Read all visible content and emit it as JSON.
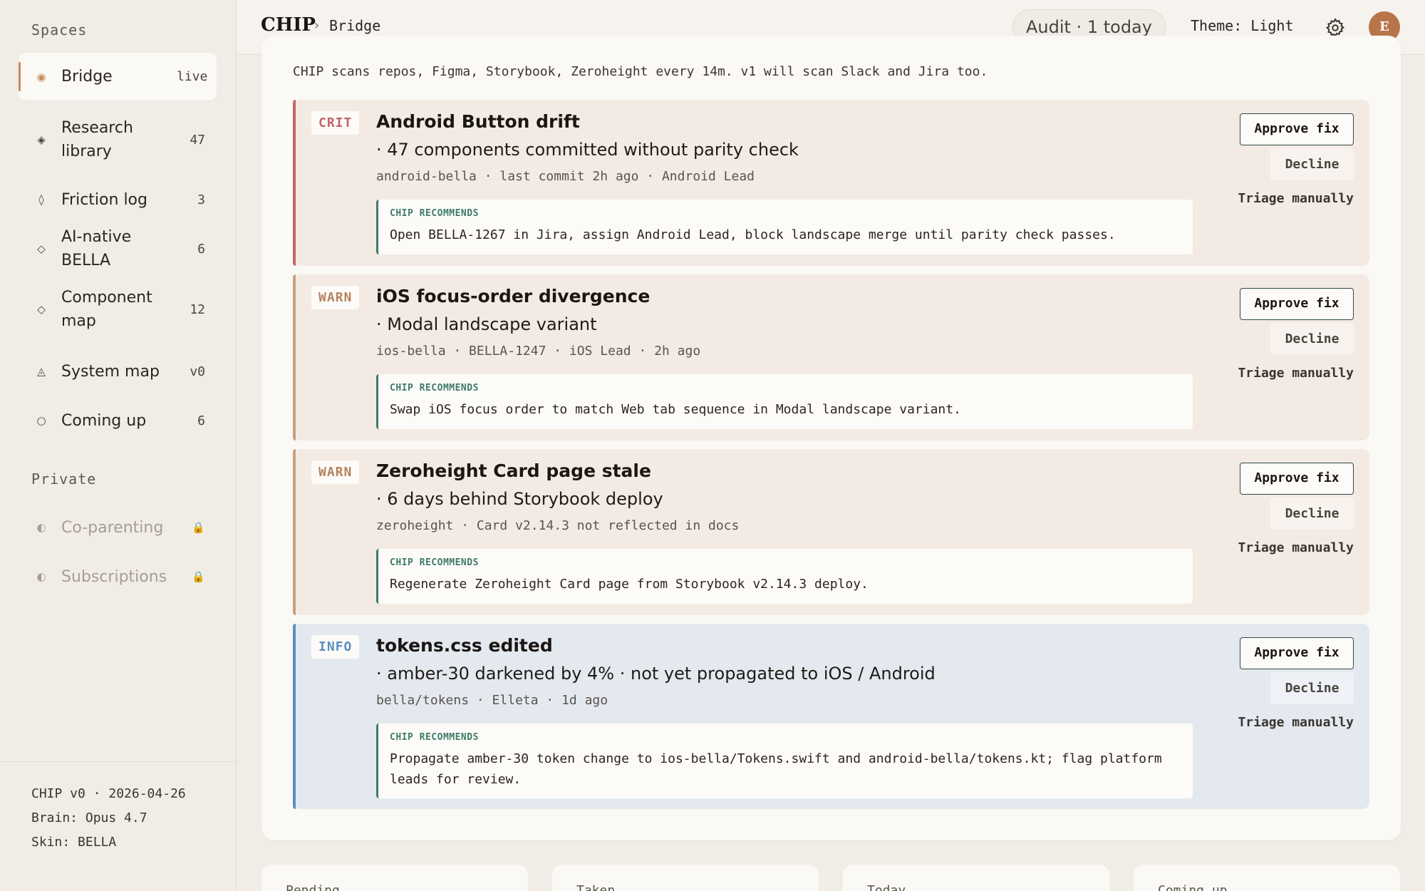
{
  "sidebar": {
    "spaces_heading": "Spaces",
    "items": [
      {
        "icon": "◉",
        "label": "Bridge",
        "count": "live"
      },
      {
        "icon": "◈",
        "label": "Research library",
        "count": "47"
      },
      {
        "icon": "◊",
        "label": "Friction log",
        "count": "3"
      },
      {
        "icon": "◇",
        "label": "AI-native BELLA",
        "count": "6"
      },
      {
        "icon": "◇",
        "label": "Component map",
        "count": "12"
      },
      {
        "icon": "◬",
        "label": "System map",
        "count": "v0"
      },
      {
        "icon": "○",
        "label": "Coming up",
        "count": "6"
      }
    ],
    "private_heading": "Private",
    "private_items": [
      {
        "icon": "◐",
        "label": "Co-parenting",
        "lock": "🔒"
      },
      {
        "icon": "◐",
        "label": "Subscriptions",
        "lock": "🔒"
      }
    ],
    "footer": {
      "version": "CHIP v0 · 2026-04-26",
      "brain": "Brain: Opus 4.7",
      "skin": "Skin: BELLA"
    }
  },
  "topbar": {
    "brand": "CHIP",
    "separator": "›",
    "crumb": "Bridge",
    "audit": "Audit · 1 today",
    "theme": "Theme: Light",
    "avatar_initial": "E"
  },
  "main": {
    "scan_note": "CHIP scans repos, Figma, Storybook, Zeroheight every 14m. v1 will scan Slack and Jira too.",
    "rec_label": "CHIP RECOMMENDS",
    "actions": {
      "approve": "Approve fix",
      "decline": "Decline",
      "triage": "Triage manually"
    },
    "alerts": [
      {
        "severity": "CRIT",
        "title": "Android Button drift",
        "subtitle": "· 47 components committed without parity check",
        "meta": "android-bella · last commit 2h ago · Android Lead",
        "recommendation": "Open BELLA-1267 in Jira, assign Android Lead, block landscape merge until parity check passes."
      },
      {
        "severity": "WARN",
        "title": "iOS focus-order divergence",
        "subtitle": "· Modal landscape variant",
        "meta": "ios-bella · BELLA-1247 · iOS Lead · 2h ago",
        "recommendation": "Swap iOS focus order to match Web tab sequence in Modal landscape variant."
      },
      {
        "severity": "WARN",
        "title": "Zeroheight Card page stale",
        "subtitle": "· 6 days behind Storybook deploy",
        "meta": "zeroheight · Card v2.14.3 not reflected in docs",
        "recommendation": "Regenerate Zeroheight Card page from Storybook v2.14.3 deploy."
      },
      {
        "severity": "INFO",
        "title": "tokens.css edited",
        "subtitle": "· amber-30 darkened by 4% · not yet propagated to iOS / Android",
        "meta": "bella/tokens · Elleta · 1d ago",
        "recommendation": "Propagate amber-30 token change to ios-bella/Tokens.swift and android-bella/tokens.kt; flag platform leads for review."
      }
    ]
  },
  "stats": [
    "Pending",
    "Taken",
    "Today",
    "Coming up"
  ],
  "colors": {
    "crit": "#c0656a",
    "warn": "#b7825c",
    "info": "#5b8fc2",
    "accent": "#c98a5e",
    "recommend": "#3f7a6a"
  }
}
